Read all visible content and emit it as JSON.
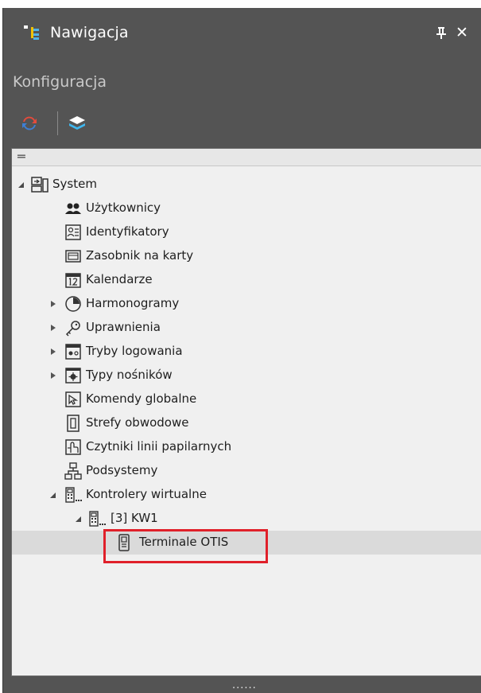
{
  "panel": {
    "title": "Nawigacja",
    "subtitle": "Konfiguracja",
    "pin_icon": "pin-icon",
    "close_label": "✕",
    "header_glyph": "═",
    "grip_glyph": "......"
  },
  "toolbar": {
    "items": [
      {
        "icon": "refresh-icon"
      },
      {
        "icon": "layers-icon"
      }
    ]
  },
  "tree": {
    "root": "System",
    "items": [
      {
        "label": "Użytkownicy",
        "icon": "users-icon"
      },
      {
        "label": "Identyfikatory",
        "icon": "id-card-icon"
      },
      {
        "label": "Zasobnik na karty",
        "icon": "card-tray-icon"
      },
      {
        "label": "Kalendarze",
        "icon": "calendar-icon"
      },
      {
        "label": "Harmonogramy",
        "icon": "clock-icon"
      },
      {
        "label": "Uprawnienia",
        "icon": "key-icon"
      },
      {
        "label": "Tryby logowania",
        "icon": "login-mode-icon"
      },
      {
        "label": "Typy nośników",
        "icon": "media-type-icon"
      },
      {
        "label": "Komendy globalne",
        "icon": "global-command-icon"
      },
      {
        "label": "Strefy obwodowe",
        "icon": "perimeter-zone-icon"
      },
      {
        "label": "Czytniki linii papilarnych",
        "icon": "fingerprint-reader-icon"
      },
      {
        "label": "Podsystemy",
        "icon": "subsystems-icon"
      },
      {
        "label": "Kontrolery wirtualne",
        "icon": "virtual-controller-icon"
      },
      {
        "label": "[3] KW1",
        "icon": "controller-icon"
      },
      {
        "label": "Terminale OTIS",
        "icon": "terminal-icon"
      }
    ]
  },
  "colors": {
    "panel_bg": "#545454",
    "tree_bg": "#f0f0f0",
    "selection": "#dadada",
    "highlight": "#e0202a"
  }
}
